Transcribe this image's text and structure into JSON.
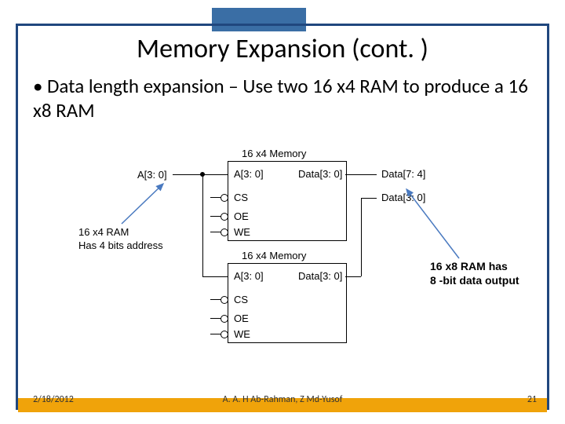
{
  "title": "Memory Expansion (cont. )",
  "bullet_text": "Data length expansion – Use two 16 x4 RAM to produce a 16 x8 RAM",
  "footer": {
    "date": "2/18/2012",
    "authors": "A. A. H Ab-Rahman, Z Md-Yusof",
    "page": "21"
  },
  "diagram": {
    "input_addr": "A[3: 0]",
    "mem1": {
      "title": "16 x4 Memory",
      "addr": "A[3: 0]",
      "data": "Data[3: 0]",
      "cs": "CS",
      "oe": "OE",
      "we": "WE"
    },
    "mem2": {
      "title": "16 x4 Memory",
      "addr": "A[3: 0]",
      "data": "Data[3: 0]",
      "cs": "CS",
      "oe": "OE",
      "we": "WE"
    },
    "out_hi": "Data[7: 4]",
    "out_lo": "Data[3: 0]",
    "callout_left_l1": "16 x4 RAM",
    "callout_left_l2": "Has 4 bits address",
    "callout_right_l1": "16 x8 RAM has",
    "callout_right_l2": "8 -bit data output"
  }
}
